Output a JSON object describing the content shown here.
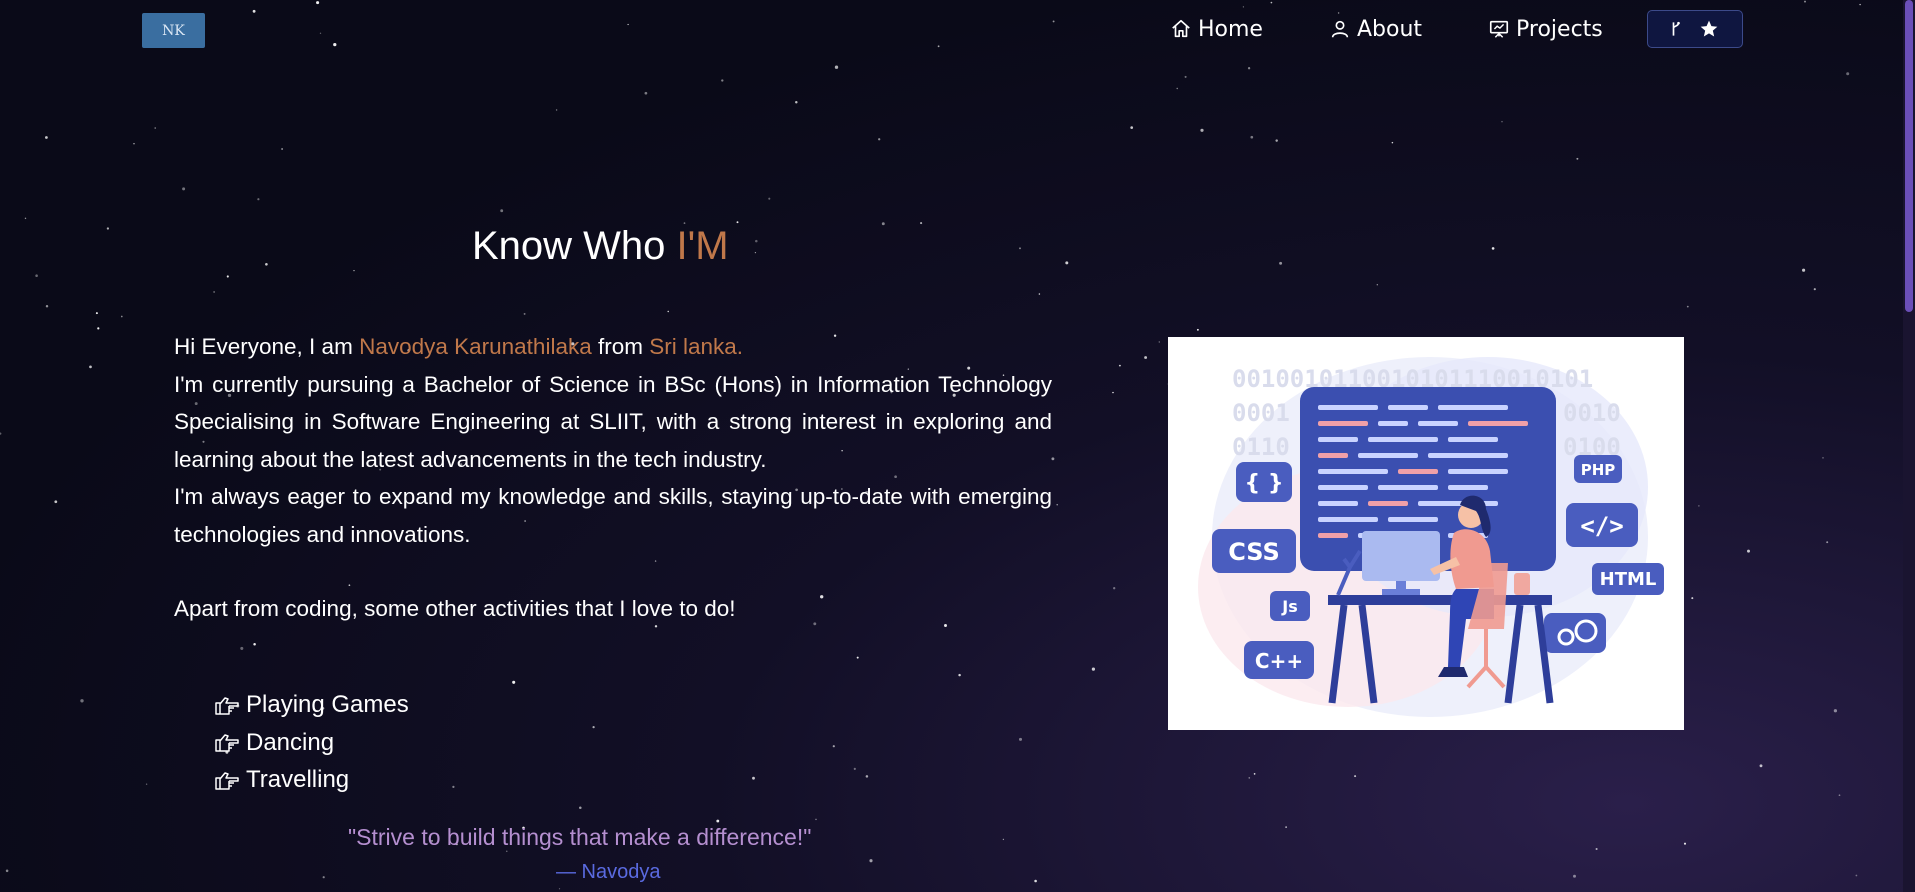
{
  "nav": {
    "logo_text": "NK",
    "items": [
      {
        "label": "Home",
        "icon": "home-icon"
      },
      {
        "label": "About",
        "icon": "user-icon"
      },
      {
        "label": "Projects",
        "icon": "projects-icon"
      }
    ],
    "github_button": {
      "icons": [
        "fork-icon",
        "star-icon"
      ]
    }
  },
  "about": {
    "heading_prefix": "Know Who ",
    "heading_accent": "I'M",
    "intro_1": "Hi Everyone, I am ",
    "name": "Navodya Karunathilaka",
    "intro_2": " from ",
    "country": "Sri lanka.",
    "paragraph_1": "I'm currently pursuing a Bachelor of Science in BSc (Hons) in Information Technology Specialising in Software Engineering at SLIIT, with a strong interest in exploring and learning about the latest advancements in the tech industry.",
    "paragraph_2": "I'm always eager to expand my knowledge and skills, staying up-to-date with emerging technologies and innovations.",
    "activities_intro": "Apart from coding, some other activities that I love to do!",
    "activities": [
      "Playing Games",
      "Dancing",
      "Travelling"
    ],
    "quote": "\"Strive to build things that make a difference!\"",
    "quote_author": "— Navodya"
  },
  "illustration": {
    "labels": [
      "CSS",
      "Js",
      "C++",
      "PHP",
      "</>",
      "HTML",
      "{ }"
    ],
    "binary_lines": [
      "0010010110010101110010101",
      "0001",
      "0010",
      "0110",
      "0100"
    ]
  },
  "colors": {
    "accent": "#c0784a",
    "quote": "#b58fd0",
    "author": "#5a6ae0",
    "background": "#0a0a18"
  }
}
